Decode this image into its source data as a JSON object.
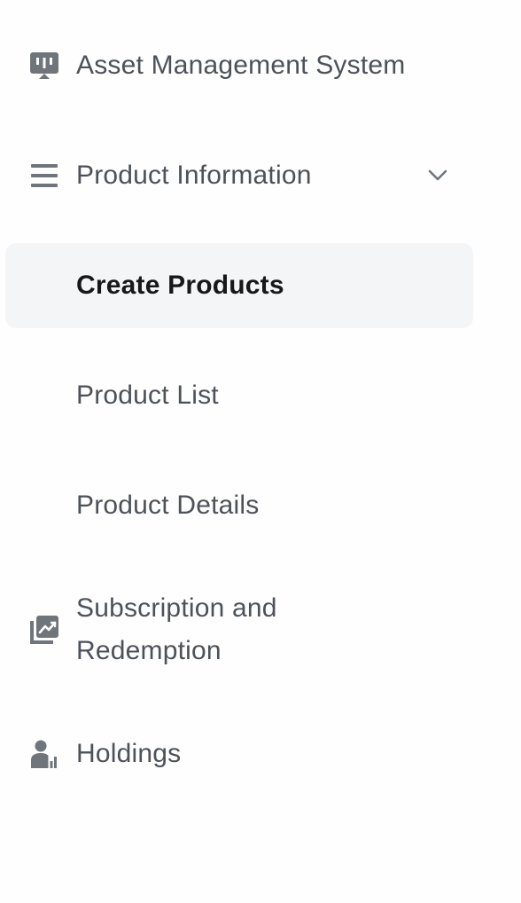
{
  "sidebar": {
    "items": [
      {
        "label": "Asset Management System",
        "icon": "dashboard-icon"
      },
      {
        "label": "Product Information",
        "icon": "list-icon",
        "expanded": true
      },
      {
        "label": "Create Products",
        "active": true
      },
      {
        "label": "Product List"
      },
      {
        "label": "Product Details"
      },
      {
        "label": "Subscription and Redemption",
        "icon": "chart-icon"
      },
      {
        "label": "Holdings",
        "icon": "person-chart-icon"
      }
    ]
  },
  "colors": {
    "text": "#4d5259",
    "active_text": "#16181b",
    "active_bg": "#f4f5f7",
    "icon": "#70757c"
  }
}
